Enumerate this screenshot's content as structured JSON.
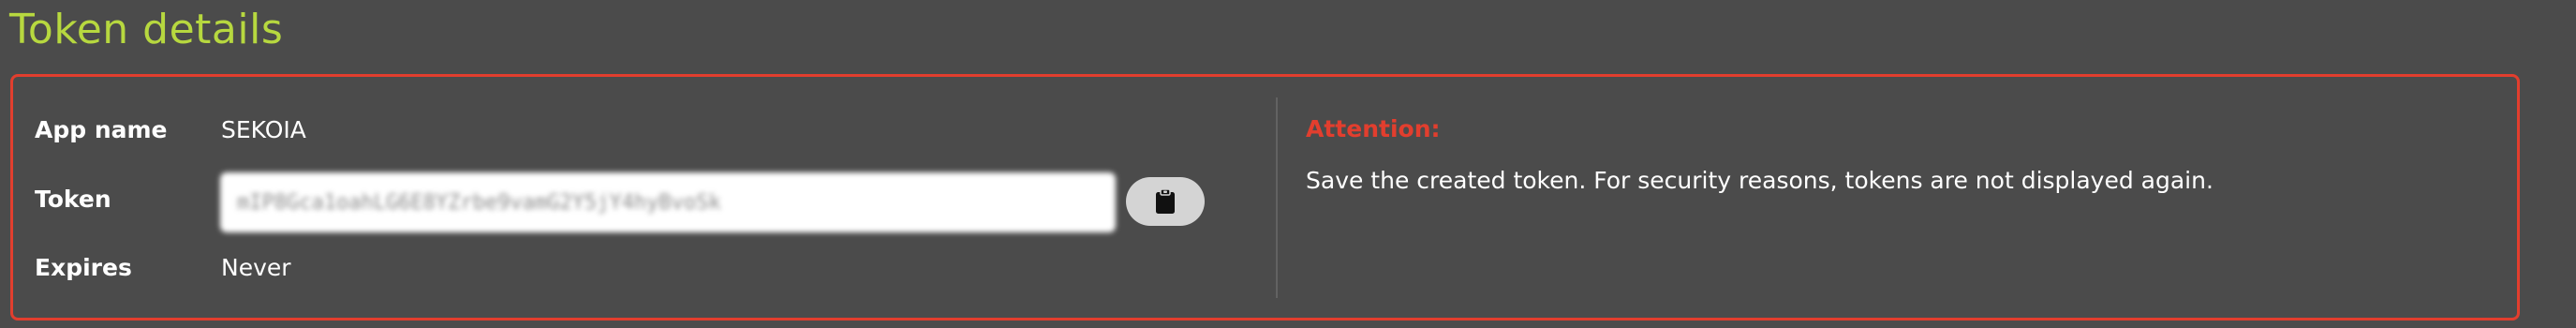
{
  "page": {
    "title": "Token details"
  },
  "details": {
    "app_name_label": "App name",
    "app_name_value": "SEKOIA",
    "token_label": "Token",
    "token_value": "mIP8Gca1oahLG6E8YZrbe9vamG2Y5jY4hyBvoSk",
    "expires_label": "Expires",
    "expires_value": "Never"
  },
  "copy_button": {
    "icon": "clipboard-icon"
  },
  "attention": {
    "title": "Attention:",
    "message": "Save the created token. For security reasons, tokens are not displayed again."
  },
  "colors": {
    "background": "#4b4b4b",
    "title_accent": "#b7d83f",
    "warning_red": "#e23e2e",
    "button_gray": "#d4d4d4"
  }
}
